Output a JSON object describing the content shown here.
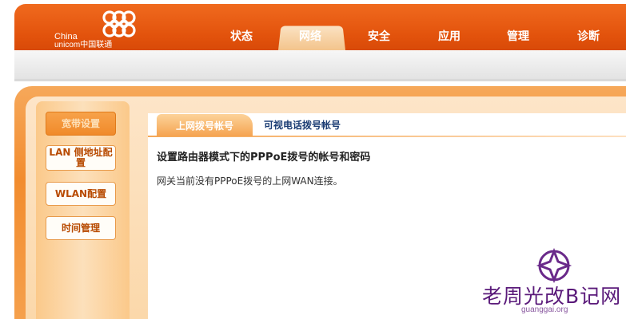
{
  "brand": {
    "name_en": "China",
    "name_line2": "unicom中国联通"
  },
  "nav": {
    "items": [
      {
        "label": "状态",
        "active": false
      },
      {
        "label": "网络",
        "active": true
      },
      {
        "label": "安全",
        "active": false
      },
      {
        "label": "应用",
        "active": false
      },
      {
        "label": "管理",
        "active": false
      },
      {
        "label": "诊断",
        "active": false
      }
    ]
  },
  "sidebar": {
    "items": [
      {
        "label": "宽带设置",
        "active": true
      },
      {
        "label": "LAN 侧地址配置",
        "active": false
      },
      {
        "label": "WLAN配置",
        "active": false
      },
      {
        "label": "时间管理",
        "active": false
      }
    ]
  },
  "tabs": [
    {
      "label": "上网拨号帐号",
      "active": true
    },
    {
      "label": "可视电话拨号帐号",
      "active": false
    }
  ],
  "main": {
    "title": "设置路由器模式下的PPPoE拨号的帐号和密码",
    "message": "网关当前没有PPPoE拨号的上网WAN连接。"
  },
  "watermark": {
    "text": "老周光改B记网",
    "url": "guanggai.org"
  },
  "colors": {
    "header_orange": "#e2520c",
    "frame_orange": "#f28c2e",
    "tab_text_blue": "#1a3c73",
    "watermark_purple": "#5a1a7a"
  }
}
